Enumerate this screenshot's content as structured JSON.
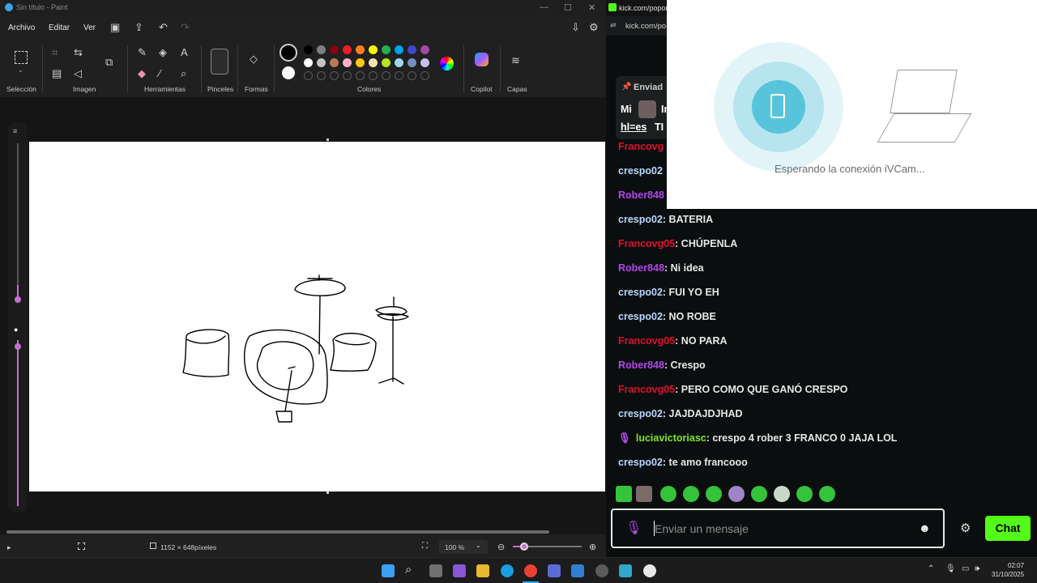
{
  "paint": {
    "title": "Sin título - Paint",
    "menu": [
      "Archivo",
      "Editar",
      "Ver"
    ],
    "groups": {
      "seleccion": "Selección",
      "imagen": "Imagen",
      "herramientas": "Herramientas",
      "pinceles": "Pinceles",
      "formas": "Formas",
      "colores": "Colores",
      "copilot": "Copilot",
      "capas": "Capas"
    },
    "palette_row1": [
      "#000000",
      "#7f7f7f",
      "#880015",
      "#ed1c24",
      "#ff7f27",
      "#fff200",
      "#22b14c",
      "#00a2e8",
      "#3f48cc",
      "#a349a4"
    ],
    "palette_row2": [
      "#ffffff",
      "#c3c3c3",
      "#b97a57",
      "#ffaec9",
      "#ffc90e",
      "#efe4b0",
      "#b5e61d",
      "#99d9ea",
      "#7092be",
      "#c8bfe7"
    ],
    "status": {
      "dimensions": "1152 × 648píxeles",
      "zoom": "100 %"
    }
  },
  "kick": {
    "tab_title": "kick.com/popout",
    "url": "kick.com/po",
    "pinned": {
      "label": "Enviad",
      "text1": "Mi",
      "text1b": "In",
      "text2": "hl=es",
      "text2b": "TI"
    },
    "messages": [
      {
        "user": "Francovg",
        "color": "#e0102e",
        "text": ""
      },
      {
        "user": "crespo02",
        "color": "#b8d8ff",
        "text": ""
      },
      {
        "user": "Rober848",
        "color": "#b145e9",
        "text": ""
      },
      {
        "user": "crespo02",
        "color": "#b8d8ff",
        "text": ": BATERIA"
      },
      {
        "user": "Francovg05",
        "color": "#e0102e",
        "text": ": CHÚPENLA"
      },
      {
        "user": "Rober848",
        "color": "#b145e9",
        "text": ": Ni idea"
      },
      {
        "user": "crespo02",
        "color": "#b8d8ff",
        "text": ": FUI YO EH"
      },
      {
        "user": "crespo02",
        "color": "#b8d8ff",
        "text": ": NO ROBE"
      },
      {
        "user": "Francovg05",
        "color": "#e0102e",
        "text": ": NO PARA"
      },
      {
        "user": "Rober848",
        "color": "#b145e9",
        "text": ": Crespo"
      },
      {
        "user": "Francovg05",
        "color": "#e0102e",
        "text": ": PERO COMO QUE GANÓ CRESPO"
      },
      {
        "user": "crespo02",
        "color": "#b8d8ff",
        "text": ": JAJDAJDJHAD"
      },
      {
        "user": "luciavictoriasc",
        "color": "#7ee81d",
        "text": ": crespo 4 rober 3 FRANCO 0 JAJA LOL"
      },
      {
        "user": "crespo02",
        "color": "#b8d8ff",
        "text": ": te amo francooo"
      }
    ],
    "input_placeholder": "Enviar un mensaje",
    "chat_button": "Chat",
    "accent": "#53fc18"
  },
  "ivcam": {
    "message": "Esperando la conexión iVCam..."
  },
  "taskbar": {
    "time": "02:07",
    "date": "31/10/2025"
  }
}
